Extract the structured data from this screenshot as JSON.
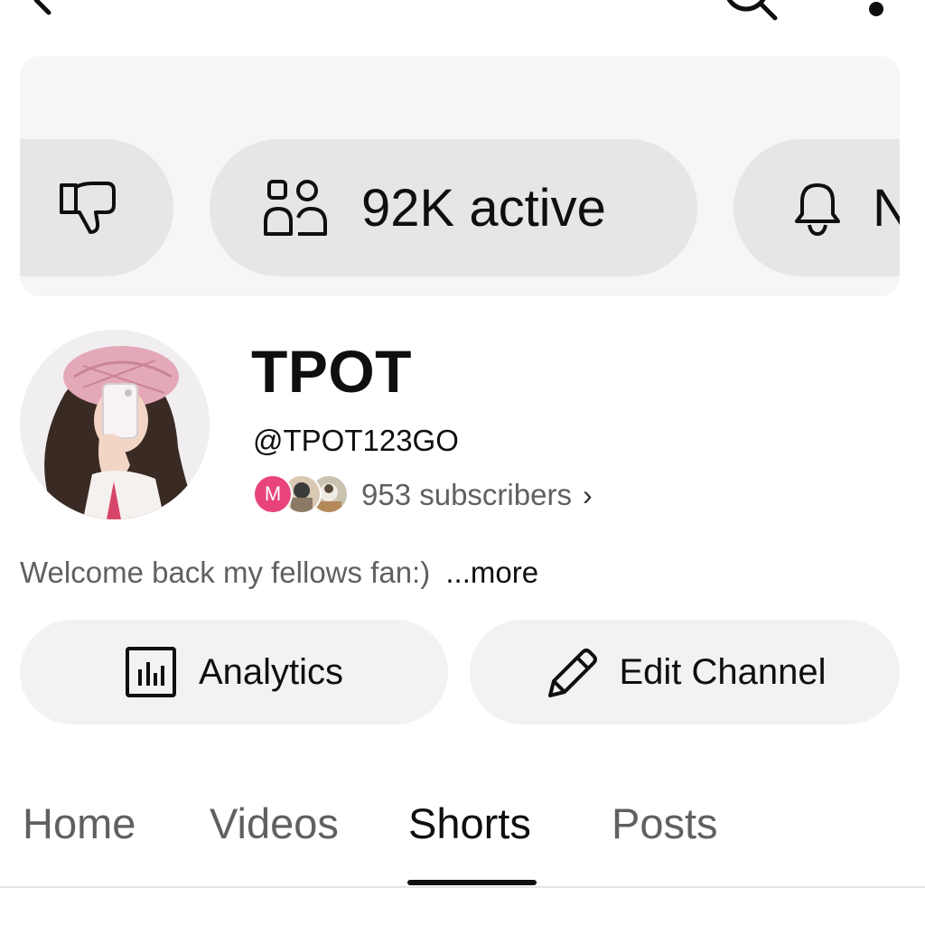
{
  "topbar": {
    "back_icon": "chevron-left-icon",
    "search_icon": "search-icon",
    "more_icon": "more-vertical-icon"
  },
  "chips": [
    {
      "icon": "thumbs-down-icon",
      "label": ""
    },
    {
      "icon": "people-icon",
      "label": "92K active"
    },
    {
      "icon": "bell-icon",
      "label": "N"
    }
  ],
  "channel": {
    "name": "TPOT",
    "handle": "@TPOT123GO",
    "subscriber_initial": "M",
    "subscribers": "953 subscribers",
    "subscribers_chevron": "›",
    "description": "Welcome back my fellows fan:)",
    "more_label": "...more"
  },
  "actions": {
    "analytics_label": "Analytics",
    "edit_label": "Edit Channel"
  },
  "tabs": [
    {
      "label": "Home",
      "active": false
    },
    {
      "label": "Videos",
      "active": false
    },
    {
      "label": "Shorts",
      "active": true
    },
    {
      "label": "Posts",
      "active": false
    }
  ],
  "colors": {
    "text_primary": "#0f0f0f",
    "text_secondary": "#606060",
    "chip_bg": "#e6e6e6",
    "panel_bg": "#f6f6f6",
    "button_bg": "#f2f2f2",
    "avatar_badge": "#e8437b"
  }
}
